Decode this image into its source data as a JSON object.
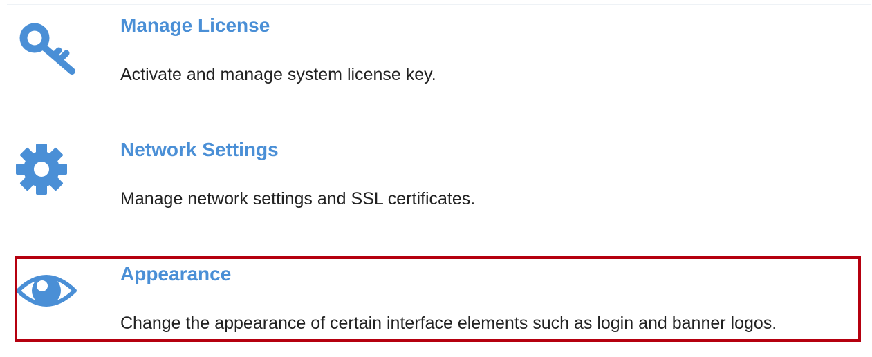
{
  "items": [
    {
      "icon": "key-icon",
      "title": "Manage License",
      "description": "Activate and manage system license key."
    },
    {
      "icon": "gear-icon",
      "title": "Network Settings",
      "description": "Manage network settings and SSL certificates."
    },
    {
      "icon": "eye-icon",
      "title": "Appearance",
      "description": "Change the appearance of certain interface elements such as login and banner logos."
    }
  ],
  "colors": {
    "accent": "#4a8fd6",
    "highlight": "#b5000f",
    "text": "#222222"
  }
}
